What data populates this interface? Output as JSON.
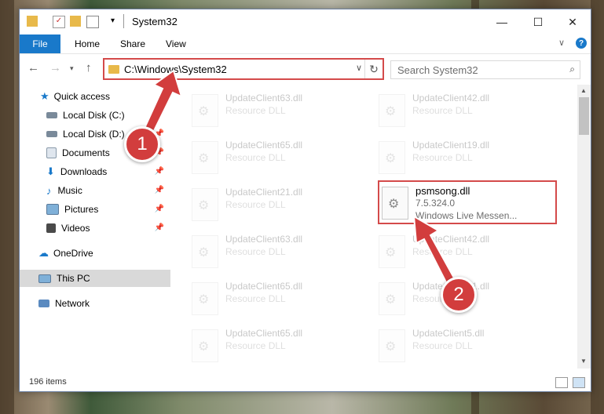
{
  "window": {
    "title": "System32",
    "controls": {
      "minimize": "—",
      "maximize": "☐",
      "close": "✕"
    }
  },
  "ribbon": {
    "tabs": [
      "File",
      "Home",
      "Share",
      "View"
    ]
  },
  "address": {
    "path": "C:\\Windows\\System32"
  },
  "search": {
    "placeholder": "Search System32"
  },
  "sidebar": {
    "items": [
      {
        "label": "Quick access",
        "icon": "star-icon"
      },
      {
        "label": "Local Disk (C:)",
        "icon": "drive-icon"
      },
      {
        "label": "Local Disk (D:)",
        "icon": "drive-icon"
      },
      {
        "label": "Documents",
        "icon": "documents-icon"
      },
      {
        "label": "Downloads",
        "icon": "download-icon"
      },
      {
        "label": "Music",
        "icon": "music-icon"
      },
      {
        "label": "Pictures",
        "icon": "pictures-icon"
      },
      {
        "label": "Videos",
        "icon": "videos-icon"
      },
      {
        "label": "OneDrive",
        "icon": "cloud-icon"
      },
      {
        "label": "This PC",
        "icon": "computer-icon"
      },
      {
        "label": "Network",
        "icon": "network-icon"
      }
    ]
  },
  "files": [
    {
      "name": "UpdateClient63.dll",
      "line2": "Resource DLL"
    },
    {
      "name": "UpdateClient42.dll",
      "line2": "Resource DLL"
    },
    {
      "name": "UpdateClient65.dll",
      "line2": "Resource DLL"
    },
    {
      "name": "UpdateClient19.dll",
      "line2": "Resource DLL"
    },
    {
      "name": "UpdateClient21.dll",
      "line2": "Resource DLL"
    },
    {
      "name": "psmsong.dll",
      "line2": "7.5.324.0",
      "line3": "Windows Live Messen..."
    },
    {
      "name": "UpdateClient63.dll",
      "line2": "Resource DLL"
    },
    {
      "name": "UpdateClient42.dll",
      "line2": "Resource DLL"
    },
    {
      "name": "UpdateClient65.dll",
      "line2": "Resource DLL"
    },
    {
      "name": "UpdateClient21.dll",
      "line2": "Resource DLL"
    },
    {
      "name": "UpdateClient65.dll",
      "line2": "Resource DLL"
    },
    {
      "name": "UpdateClient5.dll",
      "line2": "Resource DLL"
    }
  ],
  "status": {
    "items_count": "196 items"
  },
  "callouts": [
    "1",
    "2"
  ],
  "colors": {
    "accent": "#1979ca",
    "highlight": "#d44a4a",
    "callout": "#d23d3d"
  }
}
